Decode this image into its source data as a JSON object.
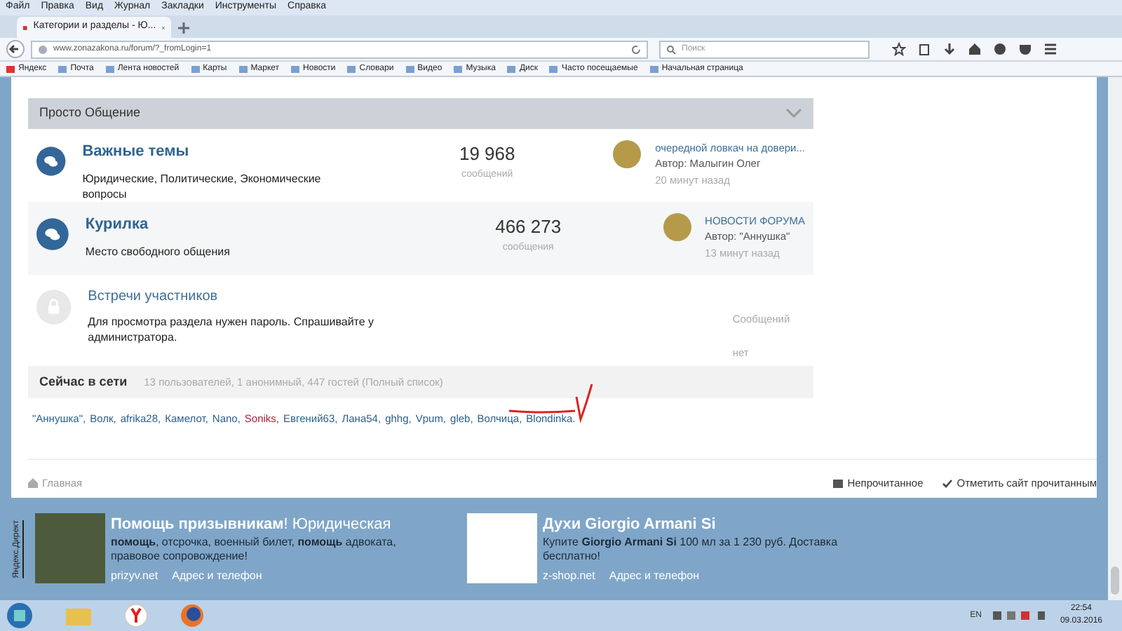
{
  "menu_bar": [
    "Файл",
    "Правка",
    "Вид",
    "Журнал",
    "Закладки",
    "Инструменты",
    "Справка"
  ],
  "tabs": [
    {
      "label": "Категории и разделы - Ю...",
      "selected": true
    }
  ],
  "address_bar": {
    "url": "www.zonazakona.ru/forum/?_fromLogin=1"
  },
  "search": {
    "placeholder": "Поиск"
  },
  "bookmarks": [
    "Яндекс",
    "Почта",
    "Лента новостей",
    "Карты",
    "Маркет",
    "Новости",
    "Словари",
    "Видео",
    "Музыка",
    "Диск",
    "Часто посещаемые",
    "Начальная страница"
  ],
  "category": {
    "title": "Просто Общение",
    "expanded": true
  },
  "forums": [
    {
      "kind": "open",
      "title": "Важные темы",
      "description": "Юридические, Политические, Экономические вопросы",
      "count": "19 968",
      "count_label": "сообщений",
      "last_post": {
        "title": "очередной ловкач на довери...",
        "author": "Автор: Малыгин Олег",
        "time": "20 минут назад"
      }
    },
    {
      "kind": "open",
      "title": "Курилка",
      "description": "Место свободного общения",
      "count": "466 273",
      "count_label": "сообщения",
      "last_post": {
        "title": "НОВОСТИ ФОРУМА",
        "author": "Автор: \"Аннушка\"",
        "time": "13 минут назад"
      }
    },
    {
      "kind": "locked",
      "title": "Встречи участников",
      "description": "Для просмотра раздела нужен пароль. Спрашивайте у администратора.",
      "no_posts": "Сообщений нет"
    }
  ],
  "online": {
    "title": "Сейчас в сети",
    "summary": "13 пользователей, 1 анонимный, 447 гостей (Полный список)",
    "users": [
      {
        "name": "\"Аннушка\",",
        "color": "#2a5f8f"
      },
      {
        "name": "Волк,",
        "color": "#2a5f8f"
      },
      {
        "name": "afrika28,",
        "color": "#2a5f8f"
      },
      {
        "name": "Камелот,",
        "color": "#2a5f8f"
      },
      {
        "name": "Nano,",
        "color": "#2a5f8f"
      },
      {
        "name": "Soniks,",
        "color": "#b0203a"
      },
      {
        "name": "Евгений63,",
        "color": "#2a5f8f"
      },
      {
        "name": "Лана54,",
        "color": "#2a5f8f"
      },
      {
        "name": "ghhg,",
        "color": "#2a5f8f"
      },
      {
        "name": "Vpum,",
        "color": "#2a5f8f"
      },
      {
        "name": "gleb,",
        "color": "#2a5f8f"
      },
      {
        "name": "Волчица,",
        "color": "#2a5f8f"
      },
      {
        "name": "Blondinka.",
        "color": "#2a5f8f"
      }
    ]
  },
  "footer": {
    "home": "Главная",
    "unread": "Непрочитанное",
    "mark_read": "Отметить сайт прочитанным"
  },
  "ad_label": "Яндекс.Директ",
  "ads": [
    {
      "title": "**Помощь призывникам**! Юридическая",
      "text": "**помощь**, отсрочка, военный билет, **помощь** адвоката, правовое сопровождение!",
      "domain": "prizyv.net",
      "address": "Адрес и телефон"
    },
    {
      "title": "Духи Giorgio Armani Si",
      "text": "Купите **Giorgio Armani Si** 100 мл за 1 230 руб. Доставка бесплатно!",
      "domain": "z-shop.net",
      "address": "Адрес и телефон"
    }
  ],
  "taskbar": {
    "language": "EN",
    "time": "22:54",
    "date": "09.03.2016"
  }
}
